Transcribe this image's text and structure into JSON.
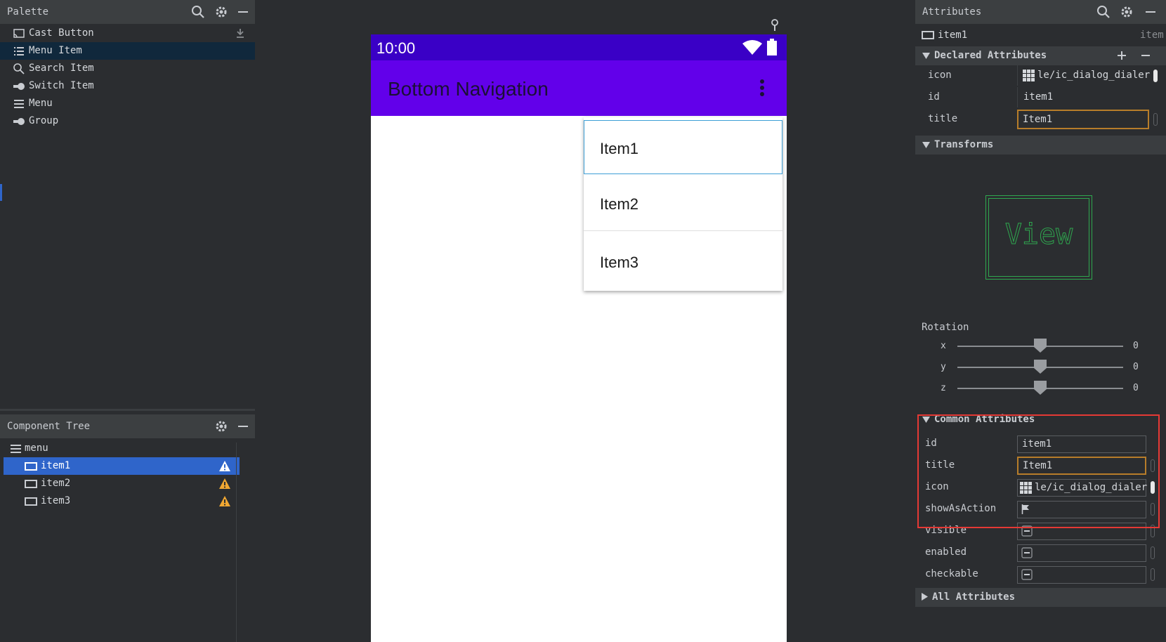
{
  "palette": {
    "title": "Palette",
    "items": [
      {
        "label": "Cast Button",
        "icon": "cast-icon"
      },
      {
        "label": "Menu Item",
        "icon": "list-icon",
        "selected": true
      },
      {
        "label": "Search Item",
        "icon": "search-icon"
      },
      {
        "label": "Switch Item",
        "icon": "switch-icon"
      },
      {
        "label": "Menu",
        "icon": "menu-icon"
      },
      {
        "label": "Group",
        "icon": "switch-icon"
      }
    ]
  },
  "component_tree": {
    "title": "Component Tree",
    "root": "menu",
    "items": [
      {
        "label": "item1",
        "selected": true
      },
      {
        "label": "item2"
      },
      {
        "label": "item3"
      }
    ]
  },
  "device": {
    "time": "10:00",
    "app_title": "Bottom Navigation",
    "menu_items": [
      "Item1",
      "Item2",
      "Item3"
    ]
  },
  "attributes": {
    "title": "Attributes",
    "component_name": "item1",
    "component_type": "item",
    "declared_header": "Declared Attributes",
    "declared": [
      {
        "key": "icon",
        "value": "le/ic_dialog_dialer"
      },
      {
        "key": "id",
        "value": "item1"
      },
      {
        "key": "title",
        "value": "Item1"
      }
    ],
    "transforms_header": "Transforms",
    "view_label": "View",
    "rotation_label": "Rotation",
    "rotation": [
      {
        "axis": "x",
        "value": "0"
      },
      {
        "axis": "y",
        "value": "0"
      },
      {
        "axis": "z",
        "value": "0"
      }
    ],
    "common_header": "Common Attributes",
    "common": [
      {
        "key": "id",
        "value": "item1"
      },
      {
        "key": "title",
        "value": "Item1"
      },
      {
        "key": "icon",
        "value": "le/ic_dialog_dialer"
      },
      {
        "key": "showAsAction",
        "value": ""
      },
      {
        "key": "visible",
        "value": ""
      },
      {
        "key": "enabled",
        "value": ""
      },
      {
        "key": "checkable",
        "value": ""
      }
    ],
    "all_header": "All Attributes"
  },
  "colors": {
    "status_bar": "#3a00c6",
    "app_bar": "#6200ea",
    "selection_blue": "#2f65ca",
    "warning": "#f0a732",
    "highlight": "#e53935"
  }
}
